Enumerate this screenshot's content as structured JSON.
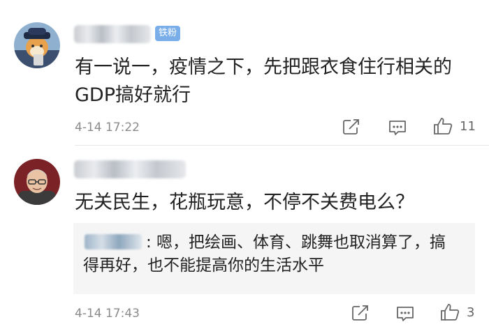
{
  "comments": [
    {
      "badge": "铁粉",
      "text": "有一说一，疫情之下，先把跟衣食住行相关的GDP搞好就行",
      "time": "4-14 17:22",
      "likes": "11"
    },
    {
      "text": "无关民生，花瓶玩意，不停不关费电么？",
      "time": "4-14 17:43",
      "likes": "3",
      "reply": {
        "text": ": 嗯，把绘画、体育、跳舞也取消算了，搞得再好，也不能提高你的生活水平"
      }
    }
  ],
  "icons": [
    "share-icon",
    "comment-icon",
    "like-icon"
  ]
}
